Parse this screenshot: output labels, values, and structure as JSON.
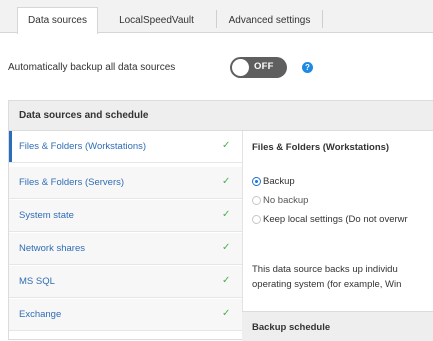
{
  "tabs": [
    {
      "label": "Data sources",
      "active": true
    },
    {
      "label": "LocalSpeedVault",
      "active": false
    },
    {
      "label": "Advanced settings",
      "active": false
    }
  ],
  "auto_backup": {
    "label": "Automatically backup all data sources",
    "toggle_state": "OFF",
    "help_icon": "question-circle-icon",
    "help_glyph": "?"
  },
  "panel": {
    "title": "Data sources and schedule",
    "sources": [
      {
        "label": "Files & Folders (Workstations)",
        "check": "✓",
        "selected": true
      },
      {
        "label": "Files & Folders (Servers)",
        "check": "✓",
        "selected": false
      },
      {
        "label": "System state",
        "check": "✓",
        "selected": false
      },
      {
        "label": "Network shares",
        "check": "✓",
        "selected": false
      },
      {
        "label": "MS SQL",
        "check": "✓",
        "selected": false
      },
      {
        "label": "Exchange",
        "check": "✓",
        "selected": false
      }
    ],
    "detail": {
      "title": "Files & Folders (Workstations)",
      "options": [
        {
          "label": "Backup",
          "checked": true
        },
        {
          "label": "No backup",
          "checked": false
        },
        {
          "label": "Keep local settings (Do not overwr",
          "checked": false
        }
      ],
      "description_line1": "This data source backs up individu",
      "description_line2": "operating system (for example, Win"
    },
    "schedule_title": "Backup schedule"
  },
  "colors": {
    "accent": "#1e73d8",
    "link_blue": "#2f6db5",
    "check_green": "#4caf50",
    "toggle_off": "#5f5f5f"
  }
}
